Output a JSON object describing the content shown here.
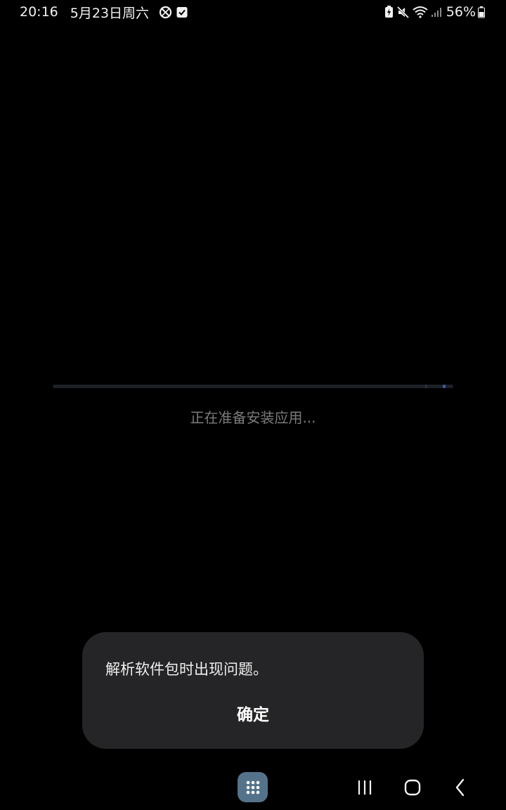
{
  "status_bar": {
    "time": "20:16",
    "date": "5月23日周六",
    "battery_percent": "56%",
    "icons": [
      "blocked-icon",
      "check-box-icon",
      "battery-saver-icon",
      "mute-icon",
      "wifi-icon",
      "signal-icon",
      "battery-icon"
    ]
  },
  "installer": {
    "status_text": "正在准备安装应用...",
    "progress_color": "#3c5ea8"
  },
  "dialog": {
    "message": "解析软件包时出现问题。",
    "ok_label": "确定"
  },
  "nav_bar": {
    "apps_button_color": "#54738a",
    "icons": [
      "apps-grid-icon",
      "recents-icon",
      "home-icon",
      "back-icon"
    ]
  }
}
